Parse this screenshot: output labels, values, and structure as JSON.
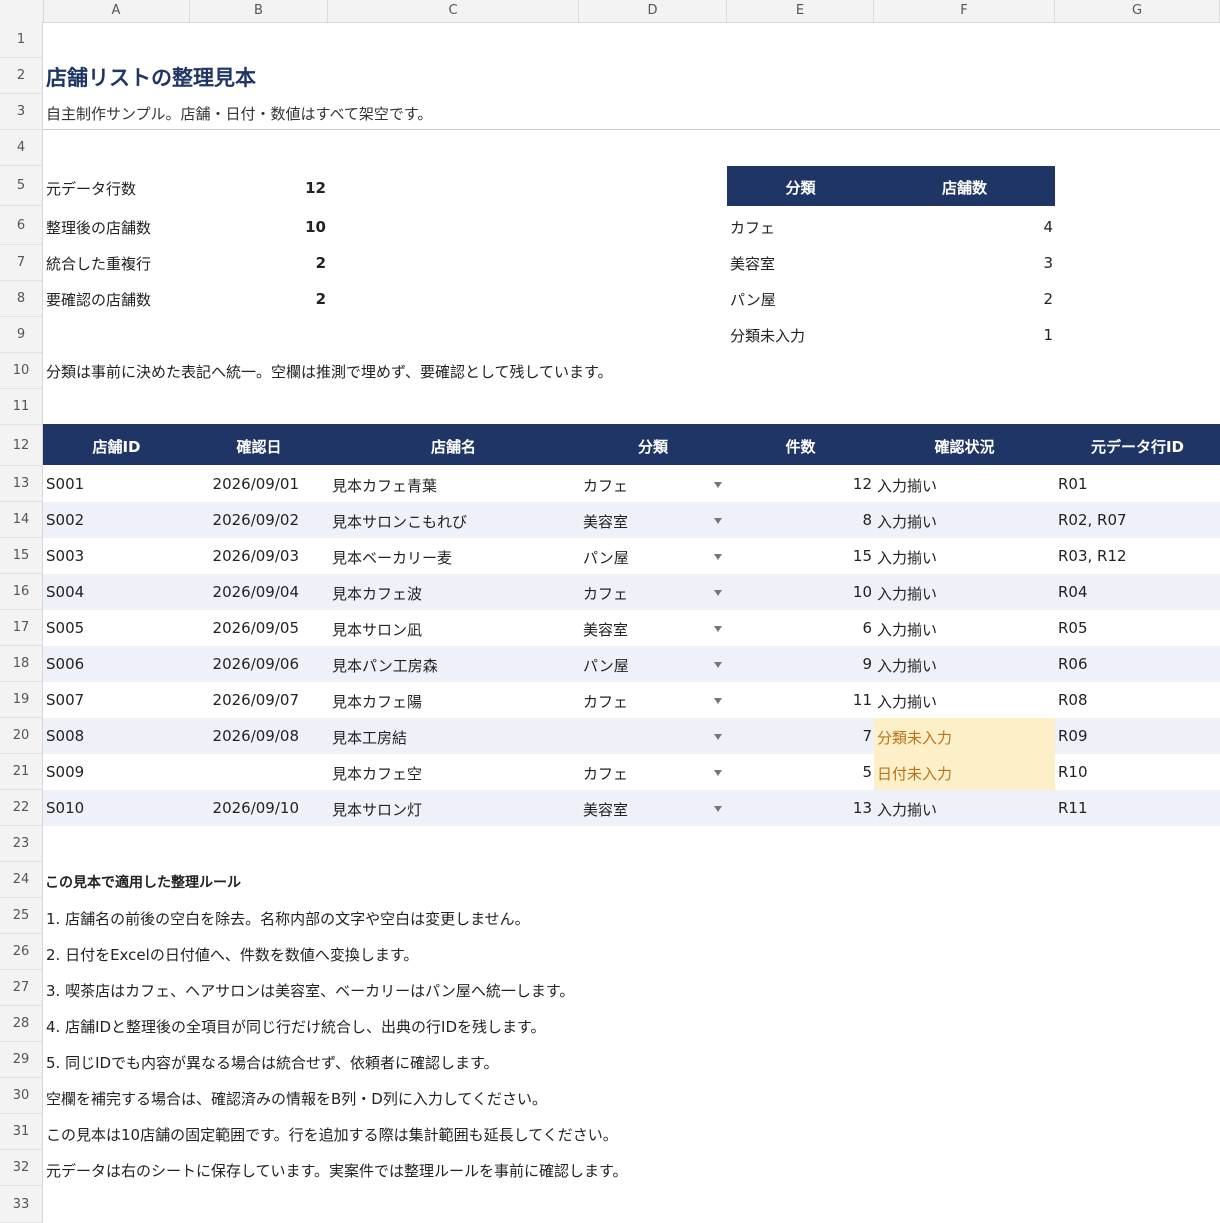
{
  "columns": [
    "A",
    "B",
    "C",
    "D",
    "E",
    "F",
    "G"
  ],
  "row_numbers": [
    "1",
    "2",
    "3",
    "4",
    "5",
    "6",
    "7",
    "8",
    "9",
    "10",
    "11",
    "12",
    "13",
    "14",
    "15",
    "16",
    "17",
    "18",
    "19",
    "20",
    "21",
    "22",
    "23",
    "24",
    "25",
    "26",
    "27",
    "28",
    "29",
    "30",
    "31",
    "32",
    "33"
  ],
  "title": "店舗リストの整理見本",
  "subtitle": "自主制作サンプル。店舗・日付・数値はすべて架空です。",
  "summary": [
    {
      "label": "元データ行数",
      "value": "12"
    },
    {
      "label": "整理後の店舗数",
      "value": "10"
    },
    {
      "label": "統合した重複行",
      "value": "2"
    },
    {
      "label": "要確認の店舗数",
      "value": "2"
    }
  ],
  "category_table": {
    "headers": [
      "分類",
      "店舗数"
    ],
    "rows": [
      {
        "name": "カフェ",
        "count": "4"
      },
      {
        "name": "美容室",
        "count": "3"
      },
      {
        "name": "パン屋",
        "count": "2"
      },
      {
        "name": "分類未入力",
        "count": "1"
      }
    ]
  },
  "note": "分類は事前に決めた表記へ統一。空欄は推測で埋めず、要確認として残しています。",
  "main_table": {
    "headers": [
      "店舗ID",
      "確認日",
      "店舗名",
      "分類",
      "件数",
      "確認状況",
      "元データ行ID"
    ],
    "rows": [
      {
        "id": "S001",
        "date": "2026/09/01",
        "name": "見本カフェ青葉",
        "category": "カフェ",
        "count": "12",
        "status": "入力揃い",
        "source": "R01"
      },
      {
        "id": "S002",
        "date": "2026/09/02",
        "name": "見本サロンこもれび",
        "category": "美容室",
        "count": "8",
        "status": "入力揃い",
        "source": "R02, R07"
      },
      {
        "id": "S003",
        "date": "2026/09/03",
        "name": "見本ベーカリー麦",
        "category": "パン屋",
        "count": "15",
        "status": "入力揃い",
        "source": "R03, R12"
      },
      {
        "id": "S004",
        "date": "2026/09/04",
        "name": "見本カフェ波",
        "category": "カフェ",
        "count": "10",
        "status": "入力揃い",
        "source": "R04"
      },
      {
        "id": "S005",
        "date": "2026/09/05",
        "name": "見本サロン凪",
        "category": "美容室",
        "count": "6",
        "status": "入力揃い",
        "source": "R05"
      },
      {
        "id": "S006",
        "date": "2026/09/06",
        "name": "見本パン工房森",
        "category": "パン屋",
        "count": "9",
        "status": "入力揃い",
        "source": "R06"
      },
      {
        "id": "S007",
        "date": "2026/09/07",
        "name": "見本カフェ陽",
        "category": "カフェ",
        "count": "11",
        "status": "入力揃い",
        "source": "R08"
      },
      {
        "id": "S008",
        "date": "2026/09/08",
        "name": "見本工房結",
        "category": "",
        "count": "7",
        "status": "分類未入力",
        "source": "R09"
      },
      {
        "id": "S009",
        "date": "",
        "name": "見本カフェ空",
        "category": "カフェ",
        "count": "5",
        "status": "日付未入力",
        "source": "R10"
      },
      {
        "id": "S010",
        "date": "2026/09/10",
        "name": "見本サロン灯",
        "category": "美容室",
        "count": "13",
        "status": "入力揃い",
        "source": "R11"
      }
    ]
  },
  "rules_title": "この見本で適用した整理ルール",
  "rules": [
    "1. 店舗名の前後の空白を除去。名称内部の文字や空白は変更しません。",
    "2. 日付をExcelの日付値へ、件数を数値へ変換します。",
    "3. 喫茶店はカフェ、ヘアサロンは美容室、ベーカリーはパン屋へ統一します。",
    "4. 店舗IDと整理後の全項目が同じ行だけ統合し、出典の行IDを残します。",
    "5. 同じIDでも内容が異なる場合は統合せず、依頼者に確認します。"
  ],
  "notes": [
    "空欄を補完する場合は、確認済みの情報をB列・D列に入力してください。",
    "この見本は10店舗の固定範囲です。行を追加する際は集計範囲も延長してください。",
    "元データは右のシートに保存しています。実案件では整理ルールを事前に確認します。"
  ],
  "colors": {
    "header_bg": "#1f3565",
    "stripe": "#eef2f8",
    "warn_bg": "#fdefc7",
    "warn_text": "#b8741a"
  }
}
